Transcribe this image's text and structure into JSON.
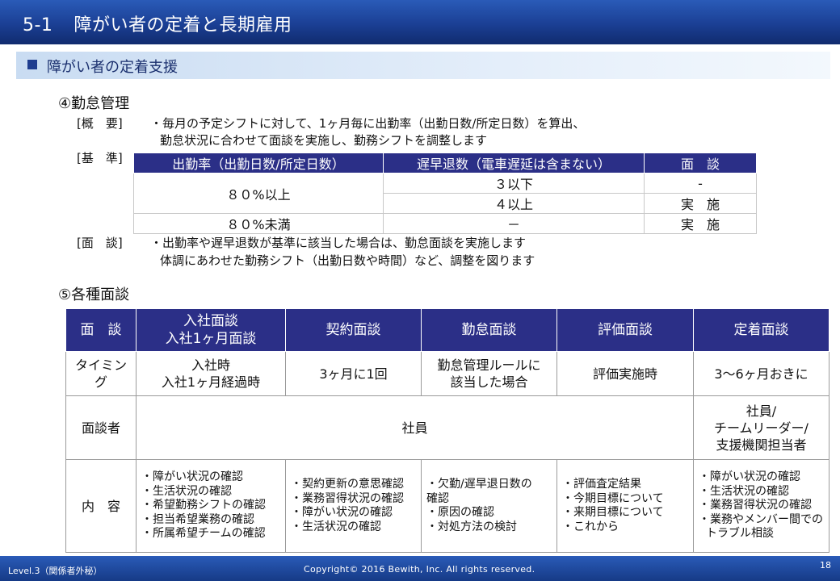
{
  "header": {
    "number": "5-1",
    "title": "障がい者の定着と長期雇用"
  },
  "section": {
    "title": "障がい者の定着支援"
  },
  "attendance": {
    "heading": "④勤怠管理",
    "overview_label": "[概　要]",
    "overview_lines": [
      "・毎月の予定シフトに対して、1ヶ月毎に出勤率（出勤日数/所定日数）を算出、",
      "勤怠状況に合わせて面談を実施し、勤務シフトを調整します"
    ],
    "criteria_label": "[基　準]",
    "criteria_table": {
      "headers": [
        "出勤率（出勤日数/所定日数）",
        "遅早退数（電車遅延は含まない）",
        "面　談"
      ],
      "rows": [
        {
          "rate": "８０%以上",
          "late": "３以下",
          "interview": "-"
        },
        {
          "late": "４以上",
          "interview": "実　施"
        },
        {
          "rate": "８０%未満",
          "late": "－",
          "interview": "実　施"
        }
      ]
    },
    "interview_label": "[面　談]",
    "interview_lines": [
      "・出勤率や遅早退数が基準に該当した場合は、勤怠面談を実施します",
      "体調にあわせた勤務シフト（出勤日数や時間）など、調整を図ります"
    ]
  },
  "interviews": {
    "heading": "⑤各種面談",
    "table": {
      "corner": "面　談",
      "columns": [
        {
          "label_lines": [
            "入社面談",
            "入社1ヶ月面談"
          ]
        },
        {
          "label_lines": [
            "契約面談"
          ]
        },
        {
          "label_lines": [
            "勤怠面談"
          ]
        },
        {
          "label_lines": [
            "評価面談"
          ]
        },
        {
          "label_lines": [
            "定着面談"
          ]
        }
      ],
      "timing_label": "タイミング",
      "timing": [
        [
          "入社時",
          "入社1ヶ月経過時"
        ],
        [
          "3ヶ月に1回"
        ],
        [
          "勤怠管理ルールに",
          "該当した場合"
        ],
        [
          "評価実施時"
        ],
        [
          "3～6ヶ月おきに"
        ]
      ],
      "interviewer_label": "面談者",
      "interviewer_common": "社員",
      "interviewer_last": [
        "社員/",
        "チームリーダー/",
        "支援機関担当者"
      ],
      "content_label": "内　容",
      "contents": [
        [
          "・障がい状況の確認",
          "・生活状況の確認",
          "・希望勤務シフトの確認",
          "・担当希望業務の確認",
          "・所属希望チームの確認"
        ],
        [
          "・契約更新の意思確認",
          "・業務習得状況の確認",
          "・障がい状況の確認",
          "・生活状況の確認"
        ],
        [
          "・欠勤/遅早退日数の",
          "確認",
          "・原因の確認",
          "・対処方法の検討"
        ],
        [
          "・評価査定結果",
          "・今期目標について",
          "・来期目標について",
          "・これから"
        ],
        [
          "・障がい状況の確認",
          "・生活状況の確認",
          "・業務習得状況の確認",
          "・業務やメンバー間での",
          "トラブル相談"
        ]
      ]
    }
  },
  "footer": {
    "level": "Level.3（関係者外秘）",
    "copyright": "Copyright© 2016 Bewith, Inc. All rights reserved.",
    "page": "18"
  },
  "colors": {
    "header_blue": "#1b3f94",
    "table_header": "#2b2f87",
    "section_band": "#c9dcf2"
  }
}
